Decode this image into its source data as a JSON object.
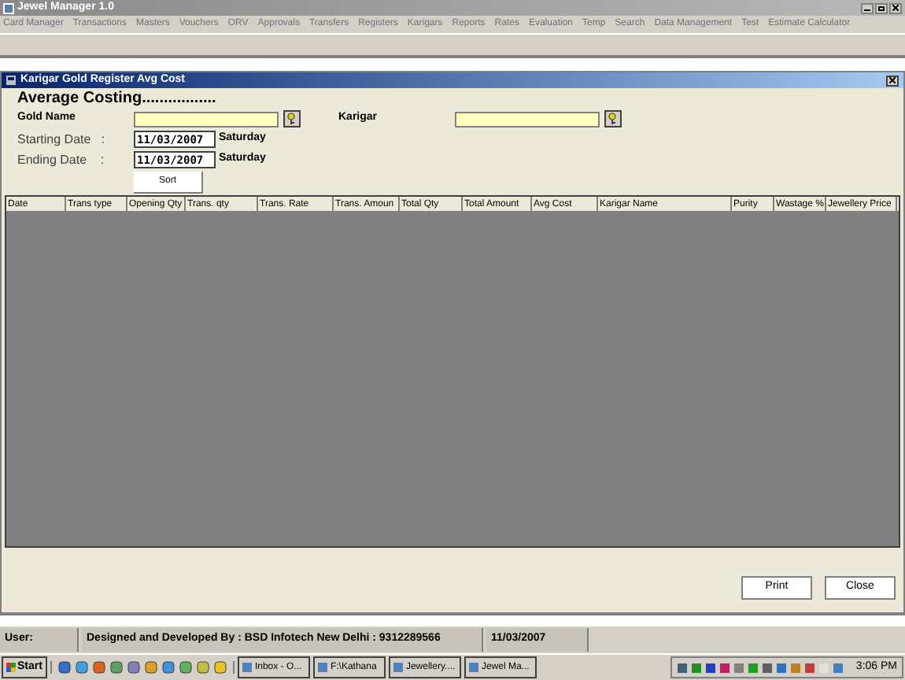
{
  "window": {
    "title": "Jewel Manager 1.0"
  },
  "menu": [
    "Card Manager",
    "Transactions",
    "Masters",
    "Vouchers",
    "ORV",
    "Approvals",
    "Transfers",
    "Registers",
    "Karigars",
    "Reports",
    "Rates",
    "Evaluation",
    "Temp",
    "Search",
    "Data Management",
    "Test",
    "Estimate Calculator"
  ],
  "child_window": {
    "title": "Karigar Gold Register Avg Cost"
  },
  "form": {
    "heading": "Average Costing.................",
    "gold_name": {
      "label": "Gold Name"
    },
    "karigar": {
      "label": "Karigar"
    },
    "starting_date": {
      "label": "Starting Date   :",
      "value": "11/03/2007",
      "day": "Saturday"
    },
    "ending_date": {
      "label": "Ending Date    :",
      "value": "11/03/2007",
      "day": "Saturday"
    },
    "sort_button": "Sort"
  },
  "table": {
    "columns": [
      "Date",
      "Trans type",
      "Opening Qty",
      "Trans. qty",
      "Trans. Rate",
      "Trans. Amoun",
      "Total Qty",
      "Total Amount",
      "Avg Cost",
      "Karigar Name",
      "Purity",
      "Wastage %",
      "Jewellery Price"
    ]
  },
  "buttons": [
    "Print",
    "Close"
  ],
  "status_bar": [
    "User:",
    "Designed and Developed By : BSD Infotech New Delhi : 9312289566",
    "11/03/2007"
  ],
  "taskbar": {
    "start": "Start",
    "tasks": [
      "Inbox - O...",
      "F:\\Kathana",
      "Jewellery....",
      "Jewel Ma..."
    ],
    "clock": "3:06 PM"
  }
}
